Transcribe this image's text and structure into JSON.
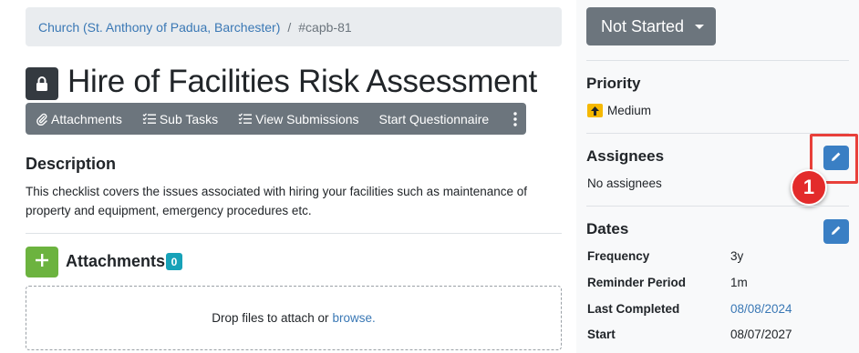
{
  "breadcrumb": {
    "parent": "Church (St. Anthony of Padua, Barchester)",
    "separator": "/",
    "current": "#capb-81"
  },
  "header": {
    "title": "Hire of Facilities Risk Assessment",
    "lock_icon": "lock-icon"
  },
  "toolbar": {
    "attachments": "Attachments",
    "sub_tasks": "Sub Tasks",
    "view_submissions": "View Submissions",
    "start_questionnaire": "Start Questionnaire"
  },
  "description": {
    "heading": "Description",
    "text": "This checklist covers the issues associated with hiring your facilities such as maintenance of property and equipment, emergency procedures etc."
  },
  "attachments": {
    "heading": "Attachments",
    "count": "0",
    "drop_text": "Drop files to attach or",
    "browse": "browse."
  },
  "sidebar": {
    "status": "Not Started",
    "priority_heading": "Priority",
    "priority_value": "Medium",
    "assignees_heading": "Assignees",
    "assignees_value": "No assignees",
    "dates_heading": "Dates",
    "dates": [
      {
        "label": "Frequency",
        "value": "3y"
      },
      {
        "label": "Reminder Period",
        "value": "1m"
      },
      {
        "label": "Last Completed",
        "value": "08/08/2024"
      },
      {
        "label": "Start",
        "value": "08/07/2027"
      }
    ]
  },
  "annotation": {
    "step_number": "1"
  },
  "colors": {
    "toolbar": "#6c757d",
    "link": "#3a78b5",
    "add_button": "#6cb33f",
    "edit_button": "#3a7fc4",
    "highlight": "#e8403a",
    "priority_medium": "#f5b800"
  }
}
